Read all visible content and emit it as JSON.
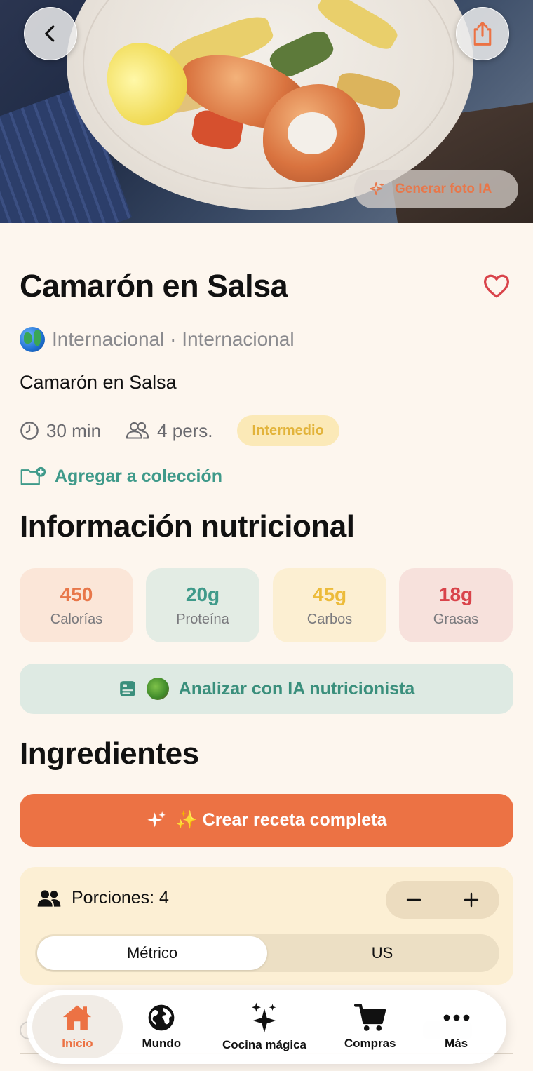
{
  "hero": {
    "generate_photo_label": "Generar foto IA"
  },
  "recipe": {
    "title": "Camarón en Salsa",
    "origin": "Internacional · Internacional",
    "subtitle": "Camarón en Salsa",
    "time": "30 min",
    "servings": "4 pers.",
    "level": "Intermedio",
    "add_collection_label": "Agregar a colección"
  },
  "nutrition": {
    "section_title": "Información nutricional",
    "items": [
      {
        "value": "450",
        "label": "Calorías",
        "color": "#e8774a",
        "bg": "#fbe6d8"
      },
      {
        "value": "20g",
        "label": "Proteína",
        "color": "#3f9a8a",
        "bg": "#e3ece4"
      },
      {
        "value": "45g",
        "label": "Carbos",
        "color": "#ecbb3a",
        "bg": "#fcefd2"
      },
      {
        "value": "18g",
        "label": "Grasas",
        "color": "#d9434a",
        "bg": "#f7e1dc"
      }
    ],
    "analyze_label": "Analizar con IA nutricionista"
  },
  "ingredients": {
    "section_title": "Ingredientes",
    "create_label": "✨ Crear receta completa",
    "portions_label": "Porciones: 4",
    "unit_options": [
      "Métrico",
      "US"
    ],
    "unit_selected": "Métrico"
  },
  "tabbar": {
    "items": [
      {
        "label": "Inicio",
        "icon": "home-icon",
        "active": true
      },
      {
        "label": "Mundo",
        "icon": "globe-icon",
        "active": false
      },
      {
        "label": "Cocina mágica",
        "icon": "sparkles-icon",
        "active": false
      },
      {
        "label": "Compras",
        "icon": "cart-icon",
        "active": false
      },
      {
        "label": "Más",
        "icon": "more-icon",
        "active": false
      }
    ]
  },
  "colors": {
    "accent": "#ec7244",
    "teal": "#3f9a8a",
    "background": "#fdf6ee"
  }
}
